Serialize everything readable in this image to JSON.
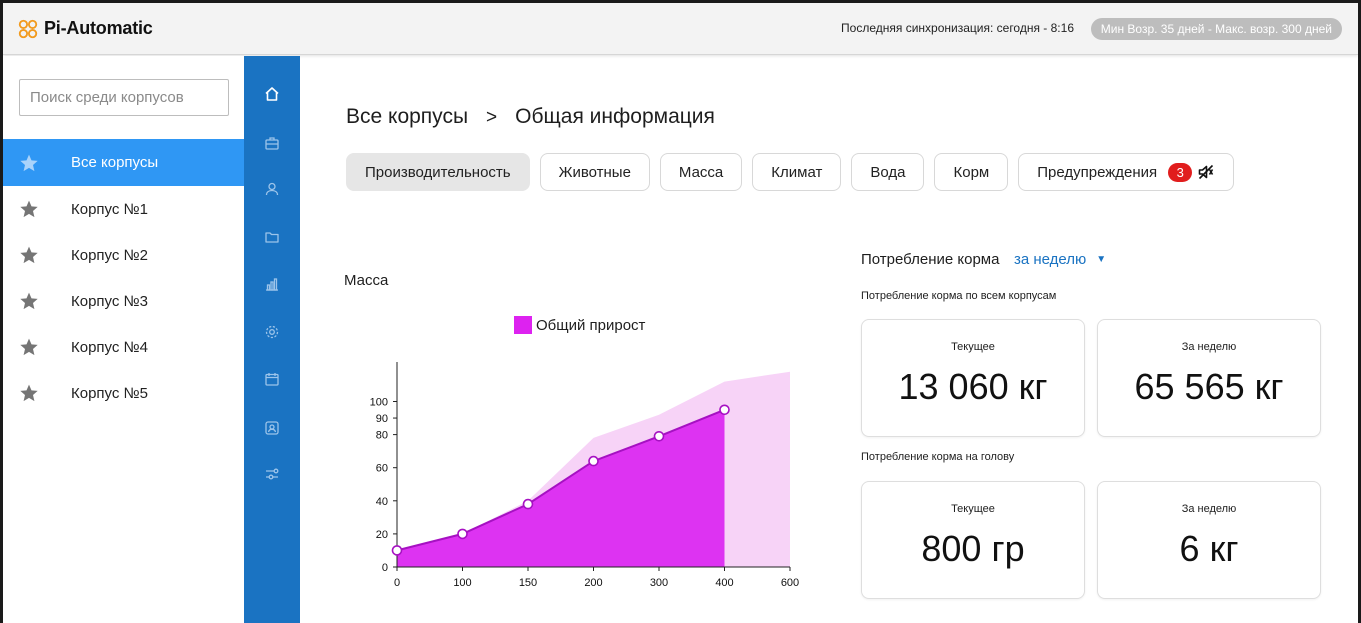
{
  "app": {
    "name": "Pi-Automatic"
  },
  "header": {
    "sync_text": "Последняя синхронизация: сегодня - 8:16",
    "age_range": "Мин Возр. 35 дней - Макс. возр. 300 дней"
  },
  "sidebar": {
    "search_placeholder": "Поиск среди корпусов",
    "items": [
      {
        "label": "Все корпусы",
        "active": true
      },
      {
        "label": "Корпус №1"
      },
      {
        "label": "Корпус №2"
      },
      {
        "label": "Корпус №3"
      },
      {
        "label": "Корпус №4"
      },
      {
        "label": "Корпус №5"
      }
    ]
  },
  "rail": {
    "icons": [
      "home-icon",
      "briefcase-icon",
      "user-icon",
      "folder-icon",
      "bar-chart-icon",
      "settings-icon",
      "calendar-icon",
      "contacts-icon",
      "sliders-icon"
    ]
  },
  "breadcrumb": {
    "root": "Все корпусы",
    "separator": ">",
    "current": "Общая информация"
  },
  "tabs": [
    {
      "label": "Производительность",
      "active": true
    },
    {
      "label": "Животные"
    },
    {
      "label": "Масса"
    },
    {
      "label": "Климат"
    },
    {
      "label": "Вода"
    },
    {
      "label": "Корм"
    },
    {
      "label": "Предупреждения",
      "badge": "3"
    }
  ],
  "mass_chart": {
    "title": "Масса",
    "legend": "Общий прирост"
  },
  "chart_data": {
    "type": "area",
    "title": "Масса",
    "xlabel": "",
    "ylabel": "",
    "x_ticks": [
      "0",
      "100",
      "150",
      "200",
      "300",
      "400",
      "600"
    ],
    "y_ticks": [
      0,
      20,
      40,
      60,
      80,
      90,
      100
    ],
    "series": [
      {
        "name": "Общий прирост",
        "x": [
          "0",
          "100",
          "150",
          "200",
          "300",
          "400"
        ],
        "values": [
          10,
          20,
          38,
          64,
          79,
          95
        ],
        "color": "#dd33f2"
      },
      {
        "x": [
          "0",
          "100",
          "150",
          "200",
          "300",
          "400",
          "600"
        ],
        "values": [
          10,
          20,
          40,
          78,
          92,
          112,
          118
        ],
        "color": "#f7d3f7"
      }
    ],
    "grid": false,
    "legend": "top-center"
  },
  "feed": {
    "title": "Потребление корма",
    "period": "за неделю",
    "all_title": "Потребление корма по всем корпусам",
    "head_title": "Потребление корма на голову",
    "cards": [
      {
        "label": "Текущее",
        "value": "13 060 кг"
      },
      {
        "label": "За неделю",
        "value": "65 565 кг"
      },
      {
        "label": "Текущее",
        "value": "800 гр"
      },
      {
        "label": "За неделю",
        "value": "6 кг"
      }
    ]
  },
  "colors": {
    "rail": "#1a73c2",
    "active_nav": "#2f97f4",
    "accent": "#dd22f0",
    "badge": "#e11d1d"
  }
}
